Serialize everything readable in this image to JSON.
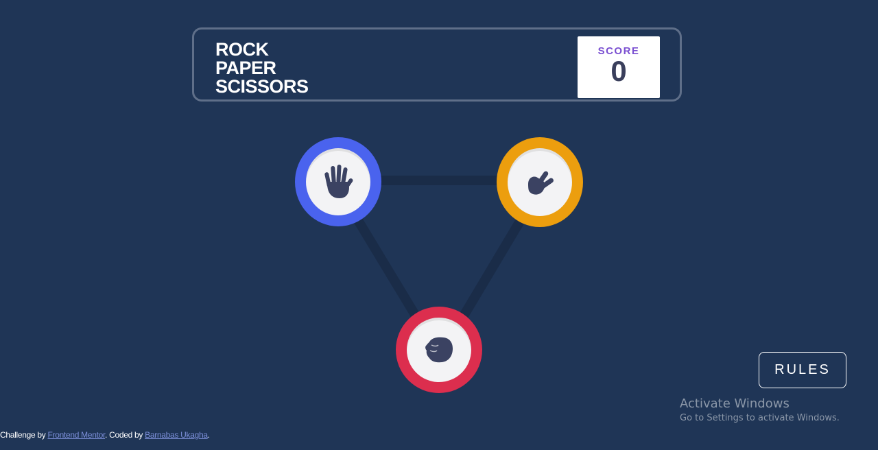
{
  "header": {
    "title_lines": [
      "ROCK",
      "PAPER",
      "SCISSORS"
    ],
    "score_label": "SCORE",
    "score_value": "0"
  },
  "tokens": {
    "paper": {
      "name": "paper",
      "ring_color": "#4a63ee",
      "icon": "paper-hand-icon"
    },
    "scissors": {
      "name": "scissors",
      "ring_color": "#ec9e0e",
      "icon": "scissors-hand-icon"
    },
    "rock": {
      "name": "rock",
      "ring_color": "#dc2e4e",
      "icon": "rock-fist-icon"
    }
  },
  "rules_button": {
    "label": "RULES"
  },
  "watermark": {
    "title": "Activate Windows",
    "subtitle": "Go to Settings to activate Windows."
  },
  "attribution": {
    "prefix": "Challenge by ",
    "link1": "Frontend Mentor",
    "middle": ". Coded by ",
    "link2": "Barnabas Ukagha",
    "suffix": "."
  },
  "colors": {
    "background": "#1f3556",
    "header_border": "#5f6f89",
    "score_label": "#7a4fd1",
    "score_value": "#3a3f5c"
  }
}
